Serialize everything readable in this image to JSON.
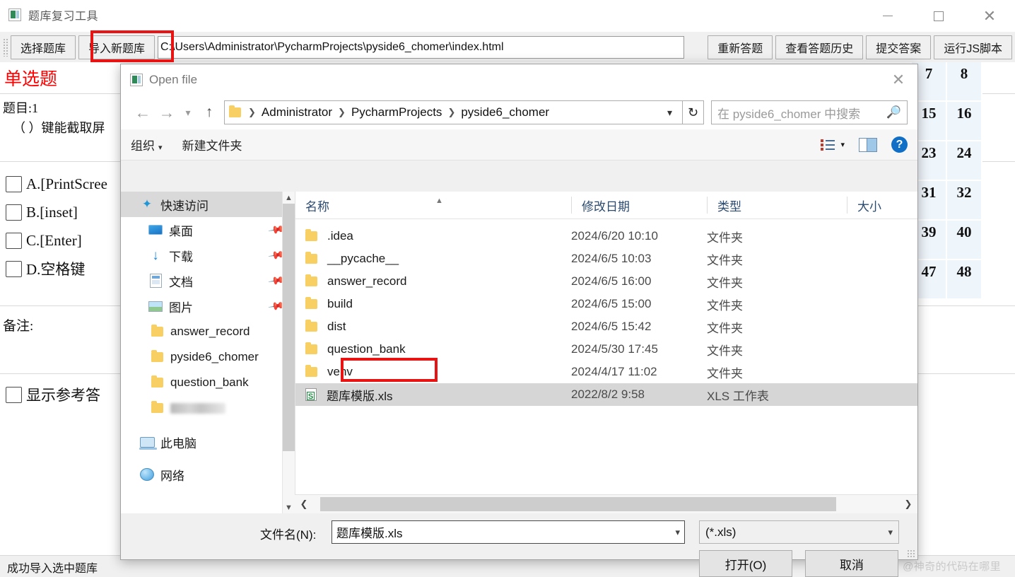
{
  "app": {
    "title": "题库复习工具",
    "window_controls": {
      "minimize": "minimize-icon",
      "maximize": "maximize-icon",
      "close": "close-icon"
    }
  },
  "toolbar": {
    "select_bank": "选择题库",
    "import_bank": "导入新题库",
    "path_value": "C:\\Users\\Administrator\\PycharmProjects\\pyside6_chomer\\index.html",
    "redo": "重新答题",
    "history": "查看答题历史",
    "submit": "提交答案",
    "run_js": "运行JS脚本",
    "highlight_color": "#e81313"
  },
  "quiz": {
    "type_label": "单选题",
    "type_color": "#ff0000",
    "stem_line1": "题目:1",
    "stem_line2": "（ ）键能截取屏",
    "options": [
      {
        "label": "A.[PrintScree",
        "checked": false
      },
      {
        "label": "B.[inset]",
        "checked": false
      },
      {
        "label": "C.[Enter]",
        "checked": false
      },
      {
        "label": "D.空格键",
        "checked": false
      }
    ],
    "remark_label": "备注:",
    "show_answer_label": "显示参考答",
    "show_answer_checked": false
  },
  "number_grid": {
    "cell_color": "#eef5fb",
    "rows": [
      [
        "7",
        "8"
      ],
      [
        "15",
        "16"
      ],
      [
        "23",
        "24"
      ],
      [
        "31",
        "32"
      ],
      [
        "39",
        "40"
      ],
      [
        "47",
        "48"
      ]
    ]
  },
  "status": {
    "message": "成功导入选中题库",
    "watermark": "CSDN @神奇的代码在哪里"
  },
  "dialog": {
    "title": "Open file",
    "nav": {
      "back": "back-arrow",
      "forward": "forward-arrow",
      "recent": "recent-dropdown",
      "up": "up-arrow"
    },
    "breadcrumbs": [
      "Administrator",
      "PycharmProjects",
      "pyside6_chomer"
    ],
    "refresh": "refresh-icon",
    "search_placeholder": "在 pyside6_chomer 中搜索",
    "commands": {
      "organize": "组织",
      "new_folder": "新建文件夹",
      "view_list": "list-view-icon",
      "preview_pane": "preview-pane-icon",
      "help": "help-icon"
    },
    "sidebar": [
      {
        "label": "快速访问",
        "icon": "star-icon",
        "selected": true,
        "pinned": false,
        "indent": 0
      },
      {
        "label": "桌面",
        "icon": "desktop-icon",
        "selected": false,
        "pinned": true,
        "indent": 1
      },
      {
        "label": "下载",
        "icon": "download-icon",
        "selected": false,
        "pinned": true,
        "indent": 1
      },
      {
        "label": "文档",
        "icon": "documents-icon",
        "selected": false,
        "pinned": true,
        "indent": 1
      },
      {
        "label": "图片",
        "icon": "pictures-icon",
        "selected": false,
        "pinned": true,
        "indent": 1
      },
      {
        "label": "answer_record",
        "icon": "folder-icon",
        "selected": false,
        "pinned": false,
        "indent": 1
      },
      {
        "label": "pyside6_chomer",
        "icon": "folder-icon",
        "selected": false,
        "pinned": false,
        "indent": 1
      },
      {
        "label": "question_bank",
        "icon": "folder-icon",
        "selected": false,
        "pinned": false,
        "indent": 1
      },
      {
        "label": "",
        "icon": "folder-icon",
        "selected": false,
        "pinned": false,
        "indent": 1,
        "blurred": true
      },
      {
        "label": "此电脑",
        "icon": "this-pc-icon",
        "selected": false,
        "pinned": false,
        "indent": 0
      },
      {
        "label": "网络",
        "icon": "network-icon",
        "selected": false,
        "pinned": false,
        "indent": 0
      }
    ],
    "columns": [
      "名称",
      "修改日期",
      "类型",
      "大小"
    ],
    "files": [
      {
        "name": ".idea",
        "date": "2024/6/20 10:10",
        "type": "文件夹",
        "size": "",
        "icon": "folder-icon",
        "selected": false
      },
      {
        "name": "__pycache__",
        "date": "2024/6/5 10:03",
        "type": "文件夹",
        "size": "",
        "icon": "folder-icon",
        "selected": false
      },
      {
        "name": "answer_record",
        "date": "2024/6/5 16:00",
        "type": "文件夹",
        "size": "",
        "icon": "folder-icon",
        "selected": false
      },
      {
        "name": "build",
        "date": "2024/6/5 15:00",
        "type": "文件夹",
        "size": "",
        "icon": "folder-icon",
        "selected": false
      },
      {
        "name": "dist",
        "date": "2024/6/5 15:42",
        "type": "文件夹",
        "size": "",
        "icon": "folder-icon",
        "selected": false
      },
      {
        "name": "question_bank",
        "date": "2024/5/30 17:45",
        "type": "文件夹",
        "size": "",
        "icon": "folder-icon",
        "selected": false
      },
      {
        "name": "venv",
        "date": "2024/4/17 11:02",
        "type": "文件夹",
        "size": "",
        "icon": "folder-icon",
        "selected": false
      },
      {
        "name": "题库模版.xls",
        "date": "2022/8/2 9:58",
        "type": "XLS 工作表",
        "size": "",
        "icon": "xls-icon",
        "selected": true
      }
    ],
    "footer": {
      "filename_label": "文件名(N):",
      "filename_value": "题库模版.xls",
      "filetype_value": "(*.xls)",
      "open_button": "打开(O)",
      "cancel_button": "取消"
    }
  }
}
